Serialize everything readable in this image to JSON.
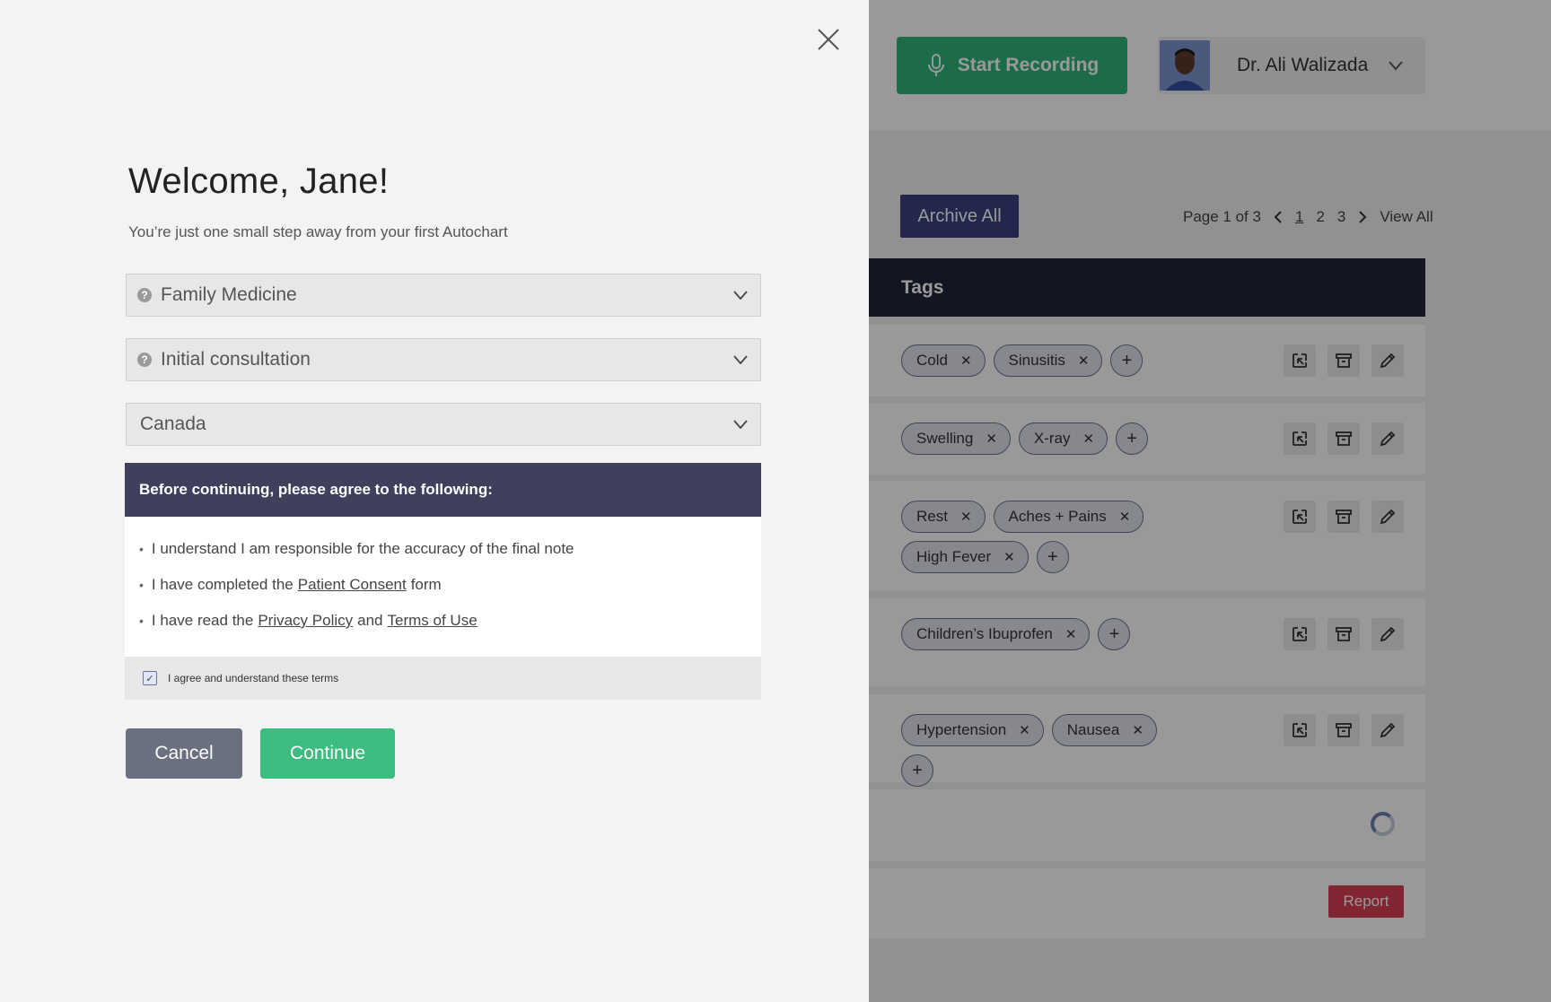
{
  "background": {
    "record_button": {
      "label": "Start Recording"
    },
    "user": {
      "name": "Dr. Ali Walizada"
    },
    "archive_button": {
      "label": "Archive All"
    },
    "pager": {
      "info": "Page 1 of 3",
      "pages": [
        "1",
        "2",
        "3"
      ],
      "view_all": "View All"
    },
    "table": {
      "tags_header": "Tags"
    },
    "rows": [
      {
        "tags": [
          "Cold",
          "Sinusitis"
        ]
      },
      {
        "tags": [
          "Swelling",
          "X-ray"
        ]
      },
      {
        "tags": [
          "Rest",
          "Aches + Pains",
          "High Fever"
        ]
      },
      {
        "tags": [
          "Children’s Ibuprofen"
        ]
      },
      {
        "tags": [
          "Hypertension",
          "Nausea"
        ]
      }
    ],
    "report_button": {
      "label": "Report"
    }
  },
  "modal": {
    "title": "Welcome, Jane!",
    "subtitle": "You’re just one small step away from your first Autochart",
    "specialty": {
      "value": "Family Medicine"
    },
    "visit_type": {
      "value": "Initial consultation"
    },
    "country": {
      "value": "Canada"
    },
    "agreement": {
      "header": "Before continuing, please agree to the following:",
      "item1": "I understand I am responsible for the accuracy of the final note",
      "item2_pre": "I have completed the",
      "item2_link": "Patient Consent",
      "item2_post": "form",
      "item3_pre": "I have read the",
      "item3_link1": "Privacy Policy",
      "item3_mid": "and",
      "item3_link2": "Terms of Use",
      "checkbox_label": "I agree and understand these terms"
    },
    "cancel_label": "Cancel",
    "continue_label": "Continue"
  },
  "colors": {
    "accent_green": "#3bbd7f",
    "header_dark": "#3e405c",
    "report_red": "#d93f55",
    "archive_blue": "#3b4282"
  }
}
